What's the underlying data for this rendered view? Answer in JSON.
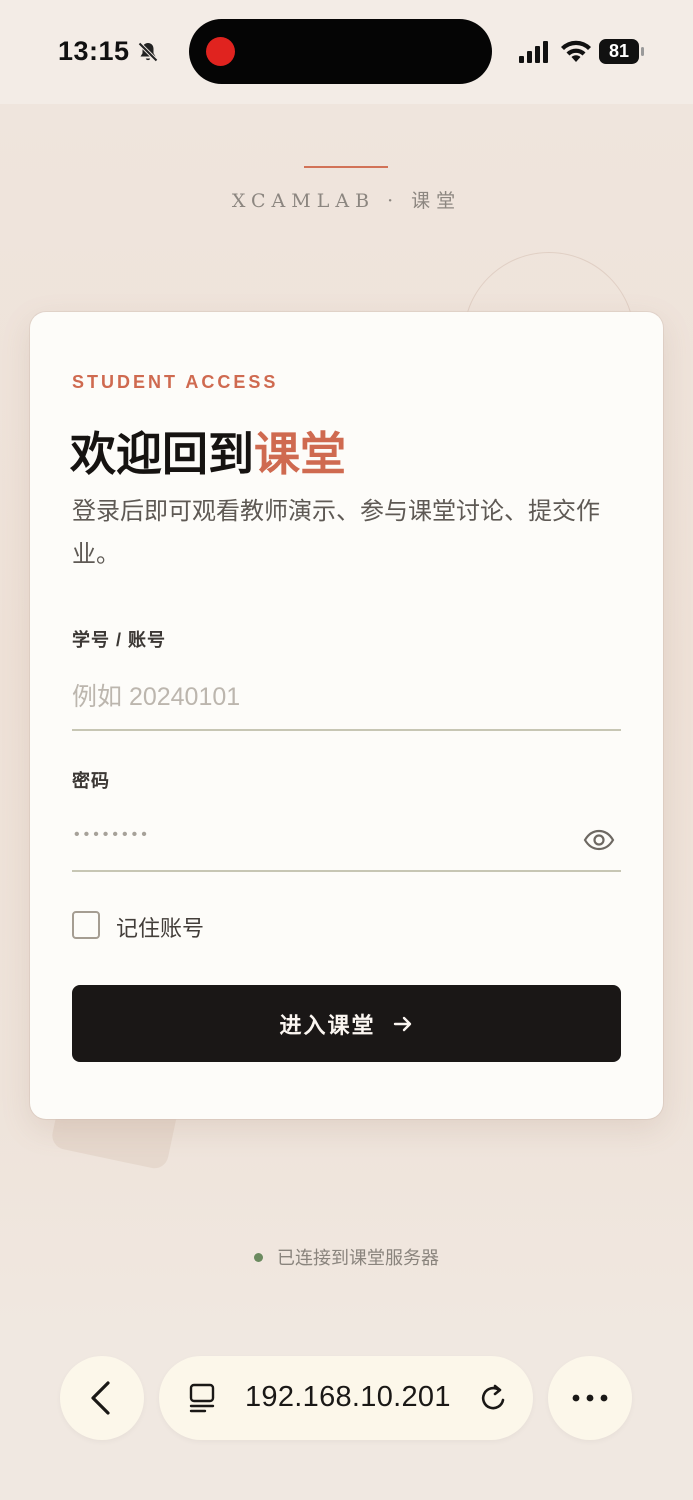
{
  "status_bar": {
    "time": "13:15",
    "battery": "81"
  },
  "brand": {
    "text": "XCAMLAB · 课堂"
  },
  "login": {
    "eyebrow": "STUDENT ACCESS",
    "title_main": "欢迎回到",
    "title_accent": "课堂",
    "description": "登录后即可观看教师演示、参与课堂讨论、提交作业。",
    "account_label": "学号 / 账号",
    "account_placeholder": "例如 20240101",
    "password_label": "密码",
    "password_mask": "••••••••",
    "remember_label": "记住账号",
    "enter_button": "进入课堂"
  },
  "server_status": {
    "text": "已连接到课堂服务器"
  },
  "browser": {
    "url": "192.168.10.201"
  },
  "colors": {
    "accent": "#cf6a50",
    "button": "#1a1716",
    "status_dot": "#6b8a5f"
  },
  "icons": [
    "bell-slash-icon",
    "signal-icon",
    "wifi-icon",
    "battery-icon",
    "eye-icon",
    "arrow-right-icon",
    "chevron-left-icon",
    "tabs-icon",
    "reload-icon",
    "more-icon"
  ]
}
